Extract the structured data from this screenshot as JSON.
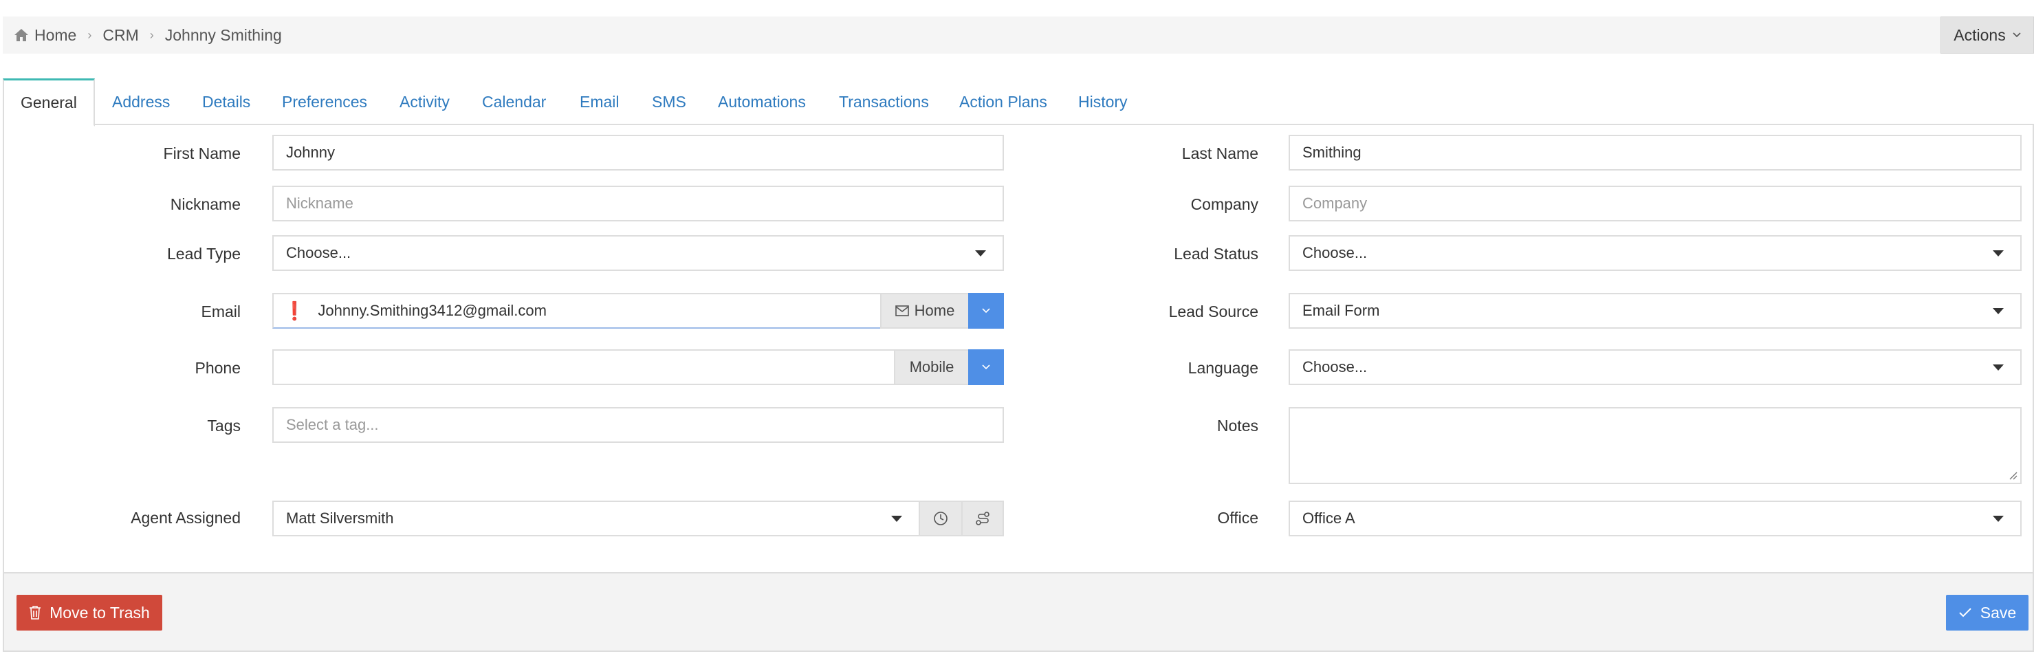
{
  "breadcrumb": {
    "items": [
      "Home",
      "CRM",
      "Johnny Smithing"
    ]
  },
  "actions_label": "Actions",
  "tabs": [
    {
      "label": "General",
      "active": true
    },
    {
      "label": "Address"
    },
    {
      "label": "Details"
    },
    {
      "label": "Preferences"
    },
    {
      "label": "Activity"
    },
    {
      "label": "Calendar"
    },
    {
      "label": "Email"
    },
    {
      "label": "SMS"
    },
    {
      "label": "Automations"
    },
    {
      "label": "Transactions"
    },
    {
      "label": "Action Plans"
    },
    {
      "label": "History"
    }
  ],
  "form": {
    "first_name": {
      "label": "First Name",
      "value": "Johnny"
    },
    "last_name": {
      "label": "Last Name",
      "value": "Smithing"
    },
    "nickname": {
      "label": "Nickname",
      "placeholder": "Nickname"
    },
    "company": {
      "label": "Company",
      "placeholder": "Company"
    },
    "lead_type": {
      "label": "Lead Type",
      "value": "Choose..."
    },
    "lead_status": {
      "label": "Lead Status",
      "value": "Choose..."
    },
    "email": {
      "label": "Email",
      "value": "Johnny.Smithing3412@gmail.com",
      "type_label": "Home"
    },
    "lead_source": {
      "label": "Lead Source",
      "value": "Email Form"
    },
    "phone": {
      "label": "Phone",
      "value": "",
      "type_label": "Mobile"
    },
    "language": {
      "label": "Language",
      "value": "Choose..."
    },
    "tags": {
      "label": "Tags",
      "placeholder": "Select a tag..."
    },
    "notes": {
      "label": "Notes",
      "value": ""
    },
    "agent_assigned": {
      "label": "Agent Assigned",
      "value": "Matt Silversmith"
    },
    "office": {
      "label": "Office",
      "value": "Office A"
    }
  },
  "footer": {
    "trash_label": "Move to Trash",
    "save_label": "Save"
  },
  "colors": {
    "accent_blue": "#4f8fe6",
    "danger_red": "#d0493a",
    "tab_active_border": "#3fb9b3",
    "link_blue": "#2f7bbf"
  }
}
